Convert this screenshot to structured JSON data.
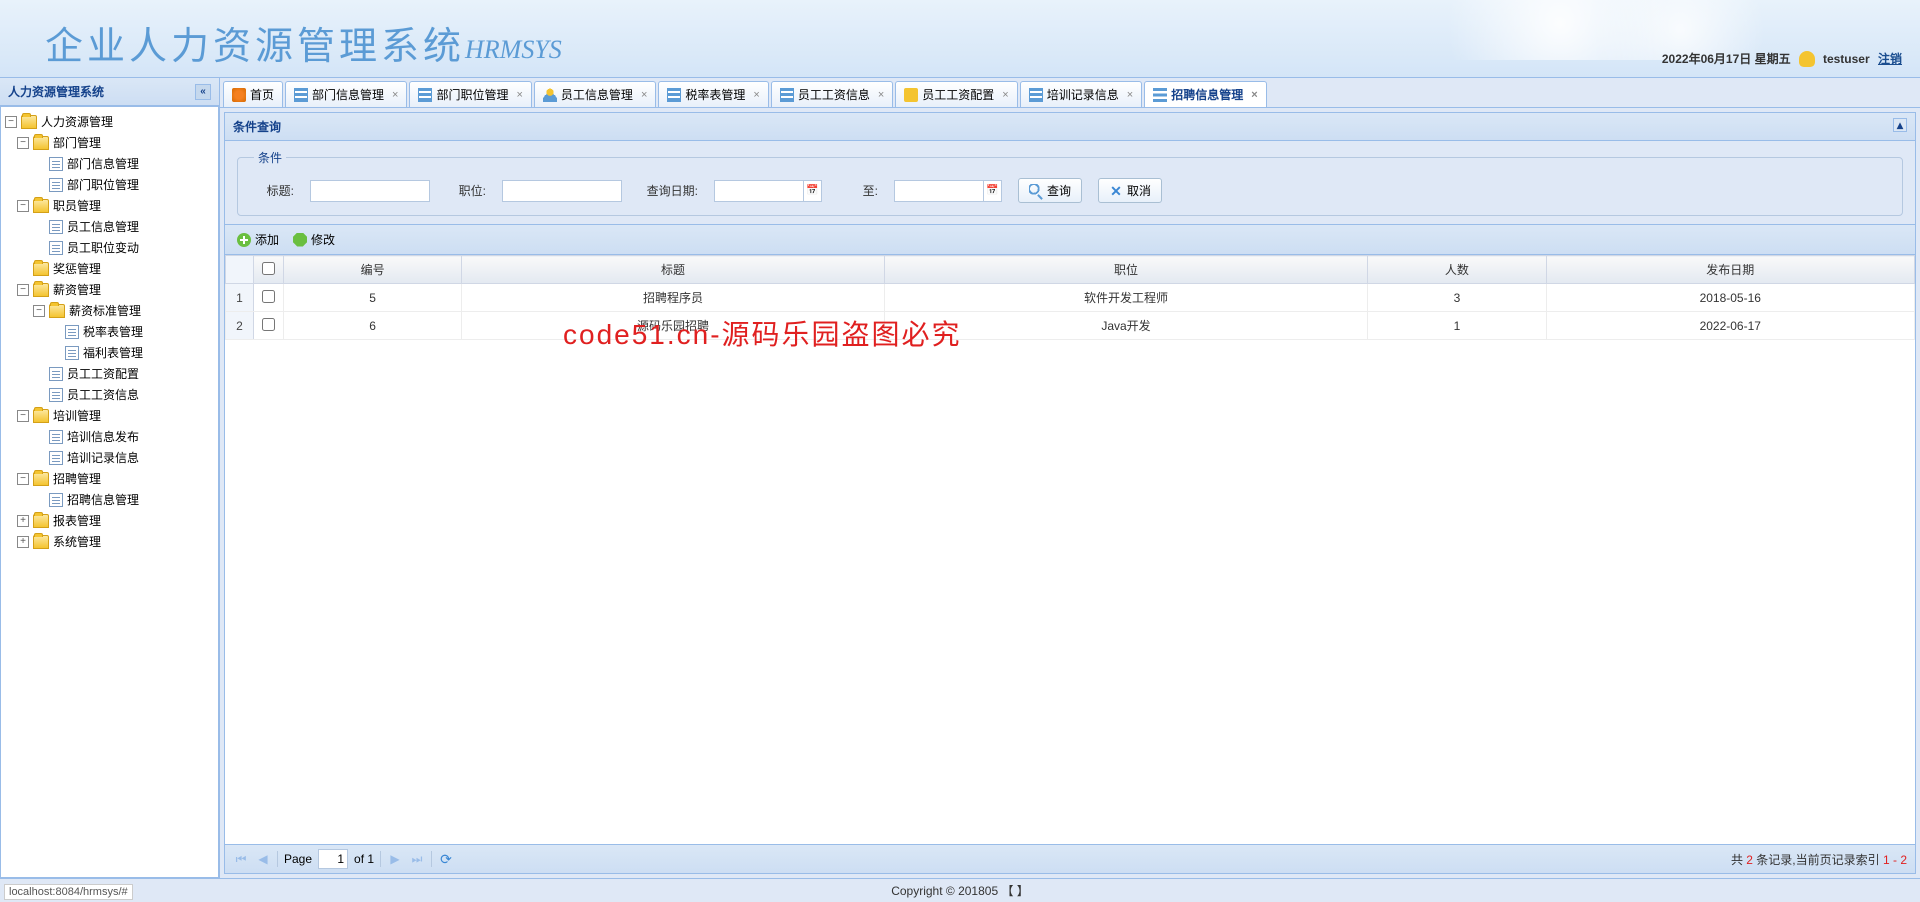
{
  "header": {
    "title": "企业人力资源管理系统",
    "subtitle": "HRMSYS",
    "date": "2022年06月17日 星期五",
    "username": "testuser",
    "logout": "注销"
  },
  "sidebar": {
    "title": "人力资源管理系统",
    "tree": {
      "root": "人力资源管理",
      "dept": "部门管理",
      "dept_info": "部门信息管理",
      "dept_pos": "部门职位管理",
      "emp": "职员管理",
      "emp_info": "员工信息管理",
      "emp_change": "员工职位变动",
      "reward": "奖惩管理",
      "salary": "薪资管理",
      "salary_std": "薪资标准管理",
      "tax": "税率表管理",
      "welfare": "福利表管理",
      "salary_cfg": "员工工资配置",
      "salary_info": "员工工资信息",
      "training": "培训管理",
      "training_pub": "培训信息发布",
      "training_rec": "培训记录信息",
      "recruit": "招聘管理",
      "recruit_info": "招聘信息管理",
      "report": "报表管理",
      "system": "系统管理"
    }
  },
  "tabs": [
    {
      "label": "首页"
    },
    {
      "label": "部门信息管理"
    },
    {
      "label": "部门职位管理"
    },
    {
      "label": "员工信息管理"
    },
    {
      "label": "税率表管理"
    },
    {
      "label": "员工工资信息"
    },
    {
      "label": "员工工资配置"
    },
    {
      "label": "培训记录信息"
    },
    {
      "label": "招聘信息管理"
    }
  ],
  "panel": {
    "title": "条件查询",
    "fieldset": "条件",
    "f_title": "标题:",
    "f_pos": "职位:",
    "f_date": "查询日期:",
    "f_to": "至:",
    "btn_query": "查询",
    "btn_cancel": "取消"
  },
  "toolbar": {
    "add": "添加",
    "edit": "修改"
  },
  "grid": {
    "cols": {
      "id": "编号",
      "title": "标题",
      "pos": "职位",
      "count": "人数",
      "date": "发布日期"
    },
    "rows": [
      {
        "num": "1",
        "id": "5",
        "title": "招聘程序员",
        "pos": "软件开发工程师",
        "count": "3",
        "date": "2018-05-16"
      },
      {
        "num": "2",
        "id": "6",
        "title": "源码乐园招聘",
        "pos": "Java开发",
        "count": "1",
        "date": "2022-06-17"
      }
    ],
    "watermark": "code51.cn-源码乐园盗图必究"
  },
  "pager": {
    "page_lbl": "Page",
    "page": "1",
    "of": "of 1",
    "info_pre": "共 ",
    "info_count": "2",
    "info_mid": " 条记录,当前页记录索引 ",
    "info_range": "1 - 2"
  },
  "footer": {
    "copyright": "Copyright © 201805  【 】",
    "status": "localhost:8084/hrmsys/#"
  }
}
